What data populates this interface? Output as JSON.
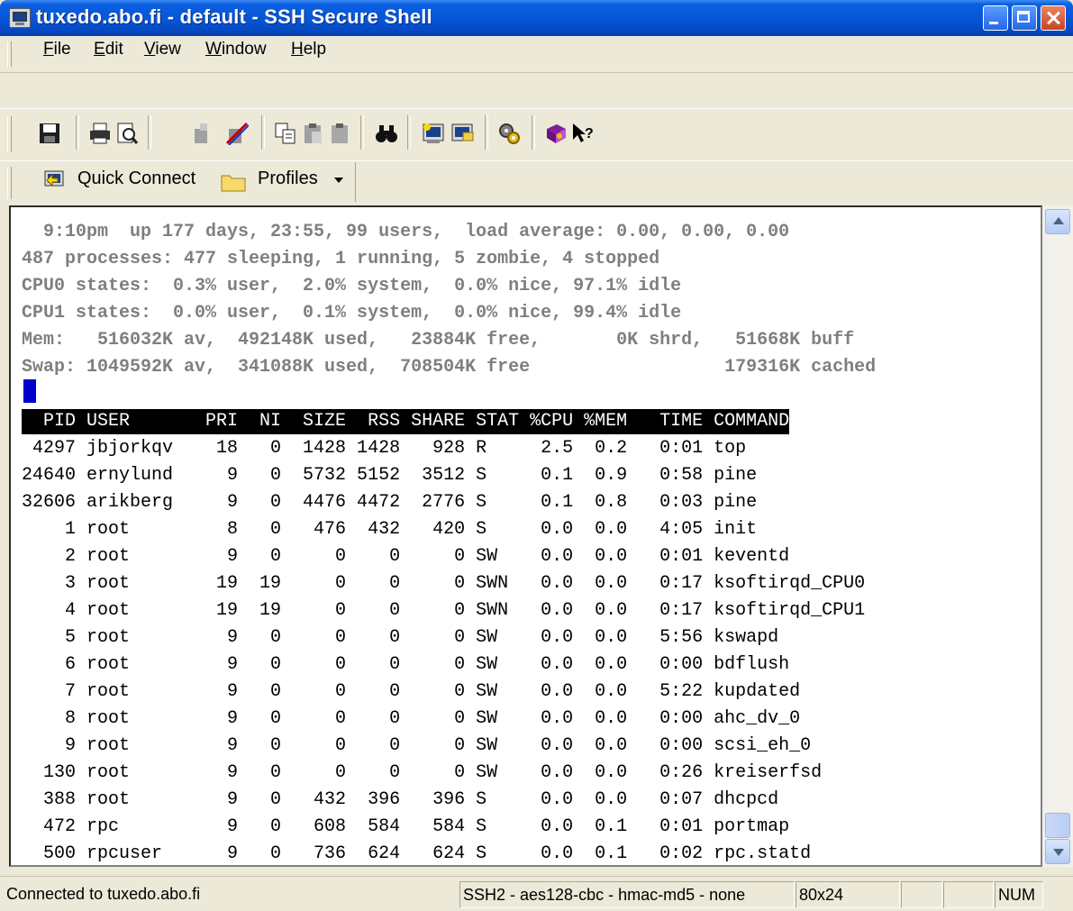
{
  "window": {
    "title": "tuxedo.abo.fi - default - SSH Secure Shell"
  },
  "menu": [
    {
      "prefix": "",
      "mnemonic": "F",
      "rest": "ile"
    },
    {
      "prefix": "",
      "mnemonic": "E",
      "rest": "dit"
    },
    {
      "prefix": "",
      "mnemonic": "V",
      "rest": "iew"
    },
    {
      "prefix": "",
      "mnemonic": "W",
      "rest": "indow"
    },
    {
      "prefix": "",
      "mnemonic": "H",
      "rest": "elp"
    }
  ],
  "toolbar": {
    "icons": [
      "save-icon",
      "print-icon",
      "print-preview-icon",
      "connect-icon",
      "disconnect-icon",
      "copy-icon",
      "paste-icon",
      "paste-clipboard-icon",
      "find-icon",
      "new-terminal-icon",
      "new-file-transfer-icon",
      "settings-icon",
      "help-book-icon",
      "context-help-icon"
    ]
  },
  "quickbar": {
    "quick_connect": "Quick Connect",
    "profiles": "Profiles"
  },
  "terminal": {
    "header_lines": [
      "  9:10pm  up 177 days, 23:55, 99 users,  load average: 0.00, 0.00, 0.00",
      "487 processes: 477 sleeping, 1 running, 5 zombie, 4 stopped",
      "CPU0 states:  0.3% user,  2.0% system,  0.0% nice, 97.1% idle",
      "CPU1 states:  0.0% user,  0.1% system,  0.0% nice, 99.4% idle",
      "Mem:   516032K av,  492148K used,   23884K free,       0K shrd,   51668K buff",
      "Swap: 1049592K av,  341088K used,  708504K free                  179316K cached"
    ],
    "columns": "  PID USER       PRI  NI  SIZE  RSS SHARE STAT %CPU %MEM   TIME COMMAND",
    "processes": [
      {
        "pid": "4297",
        "user": "jbjorkqv",
        "pri": "18",
        "ni": "0",
        "size": "1428",
        "rss": "1428",
        "share": "928",
        "stat": "R",
        "cpu": "2.5",
        "mem": "0.2",
        "time": "0:01",
        "command": "top"
      },
      {
        "pid": "24640",
        "user": "ernylund",
        "pri": "9",
        "ni": "0",
        "size": "5732",
        "rss": "5152",
        "share": "3512",
        "stat": "S",
        "cpu": "0.1",
        "mem": "0.9",
        "time": "0:58",
        "command": "pine"
      },
      {
        "pid": "32606",
        "user": "arikberg",
        "pri": "9",
        "ni": "0",
        "size": "4476",
        "rss": "4472",
        "share": "2776",
        "stat": "S",
        "cpu": "0.1",
        "mem": "0.8",
        "time": "0:03",
        "command": "pine"
      },
      {
        "pid": "1",
        "user": "root",
        "pri": "8",
        "ni": "0",
        "size": "476",
        "rss": "432",
        "share": "420",
        "stat": "S",
        "cpu": "0.0",
        "mem": "0.0",
        "time": "4:05",
        "command": "init"
      },
      {
        "pid": "2",
        "user": "root",
        "pri": "9",
        "ni": "0",
        "size": "0",
        "rss": "0",
        "share": "0",
        "stat": "SW",
        "cpu": "0.0",
        "mem": "0.0",
        "time": "0:01",
        "command": "keventd"
      },
      {
        "pid": "3",
        "user": "root",
        "pri": "19",
        "ni": "19",
        "size": "0",
        "rss": "0",
        "share": "0",
        "stat": "SWN",
        "cpu": "0.0",
        "mem": "0.0",
        "time": "0:17",
        "command": "ksoftirqd_CPU0"
      },
      {
        "pid": "4",
        "user": "root",
        "pri": "19",
        "ni": "19",
        "size": "0",
        "rss": "0",
        "share": "0",
        "stat": "SWN",
        "cpu": "0.0",
        "mem": "0.0",
        "time": "0:17",
        "command": "ksoftirqd_CPU1"
      },
      {
        "pid": "5",
        "user": "root",
        "pri": "9",
        "ni": "0",
        "size": "0",
        "rss": "0",
        "share": "0",
        "stat": "SW",
        "cpu": "0.0",
        "mem": "0.0",
        "time": "5:56",
        "command": "kswapd"
      },
      {
        "pid": "6",
        "user": "root",
        "pri": "9",
        "ni": "0",
        "size": "0",
        "rss": "0",
        "share": "0",
        "stat": "SW",
        "cpu": "0.0",
        "mem": "0.0",
        "time": "0:00",
        "command": "bdflush"
      },
      {
        "pid": "7",
        "user": "root",
        "pri": "9",
        "ni": "0",
        "size": "0",
        "rss": "0",
        "share": "0",
        "stat": "SW",
        "cpu": "0.0",
        "mem": "0.0",
        "time": "5:22",
        "command": "kupdated"
      },
      {
        "pid": "8",
        "user": "root",
        "pri": "9",
        "ni": "0",
        "size": "0",
        "rss": "0",
        "share": "0",
        "stat": "SW",
        "cpu": "0.0",
        "mem": "0.0",
        "time": "0:00",
        "command": "ahc_dv_0"
      },
      {
        "pid": "9",
        "user": "root",
        "pri": "9",
        "ni": "0",
        "size": "0",
        "rss": "0",
        "share": "0",
        "stat": "SW",
        "cpu": "0.0",
        "mem": "0.0",
        "time": "0:00",
        "command": "scsi_eh_0"
      },
      {
        "pid": "130",
        "user": "root",
        "pri": "9",
        "ni": "0",
        "size": "0",
        "rss": "0",
        "share": "0",
        "stat": "SW",
        "cpu": "0.0",
        "mem": "0.0",
        "time": "0:26",
        "command": "kreiserfsd"
      },
      {
        "pid": "388",
        "user": "root",
        "pri": "9",
        "ni": "0",
        "size": "432",
        "rss": "396",
        "share": "396",
        "stat": "S",
        "cpu": "0.0",
        "mem": "0.0",
        "time": "0:07",
        "command": "dhcpcd"
      },
      {
        "pid": "472",
        "user": "rpc",
        "pri": "9",
        "ni": "0",
        "size": "608",
        "rss": "584",
        "share": "584",
        "stat": "S",
        "cpu": "0.0",
        "mem": "0.1",
        "time": "0:01",
        "command": "portmap"
      },
      {
        "pid": "500",
        "user": "rpcuser",
        "pri": "9",
        "ni": "0",
        "size": "736",
        "rss": "624",
        "share": "624",
        "stat": "S",
        "cpu": "0.0",
        "mem": "0.1",
        "time": "0:02",
        "command": "rpc.statd"
      }
    ]
  },
  "statusbar": {
    "connection": "Connected to tuxedo.abo.fi",
    "cipher": "SSH2 - aes128-cbc - hmac-md5 - none",
    "size": "80x24",
    "num": "NUM"
  }
}
